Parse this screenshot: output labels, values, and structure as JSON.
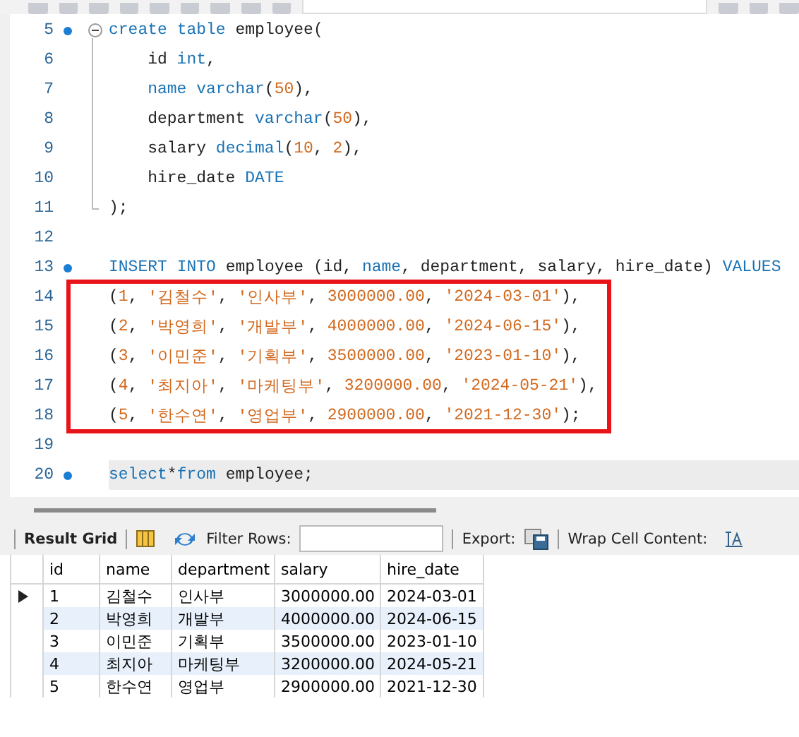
{
  "editor": {
    "lines": [
      {
        "number": "5",
        "marker": true,
        "boxed": false,
        "current": false,
        "expanded": true,
        "tokens": [
          {
            "kind": "keyword",
            "text": "create"
          },
          {
            "kind": "keyword",
            "text": " table"
          },
          {
            "kind": "plain",
            "text": " employee("
          }
        ],
        "children": [
          {
            "number": "6",
            "marker": false,
            "boxed": false,
            "current": false,
            "indented": true,
            "tokens": [
              {
                "kind": "plain",
                "text": "id"
              },
              {
                "kind": "keyword",
                "text": " int"
              },
              {
                "kind": "plain",
                "text": ","
              }
            ]
          },
          {
            "number": "7",
            "marker": false,
            "boxed": false,
            "current": false,
            "indented": true,
            "tokens": [
              {
                "kind": "keyword",
                "text": "name"
              },
              {
                "kind": "keyword",
                "text": " varchar"
              },
              {
                "kind": "plain",
                "text": "("
              },
              {
                "kind": "number",
                "text": "50"
              },
              {
                "kind": "plain",
                "text": "),"
              }
            ]
          },
          {
            "number": "8",
            "marker": false,
            "boxed": false,
            "current": false,
            "indented": true,
            "tokens": [
              {
                "kind": "plain",
                "text": "department"
              },
              {
                "kind": "keyword",
                "text": " varchar"
              },
              {
                "kind": "plain",
                "text": "("
              },
              {
                "kind": "number",
                "text": "50"
              },
              {
                "kind": "plain",
                "text": "),"
              }
            ]
          },
          {
            "number": "9",
            "marker": false,
            "boxed": false,
            "current": false,
            "indented": true,
            "tokens": [
              {
                "kind": "plain",
                "text": "salary"
              },
              {
                "kind": "keyword",
                "text": " decimal"
              },
              {
                "kind": "plain",
                "text": "("
              },
              {
                "kind": "number",
                "text": "10"
              },
              {
                "kind": "plain",
                "text": ","
              },
              {
                "kind": "number",
                "text": " 2"
              },
              {
                "kind": "plain",
                "text": "),"
              }
            ]
          },
          {
            "number": "10",
            "marker": false,
            "boxed": false,
            "current": false,
            "indented": true,
            "tokens": [
              {
                "kind": "plain",
                "text": "hire_date"
              },
              {
                "kind": "keyword",
                "text": " DATE"
              }
            ]
          },
          {
            "number": "11",
            "marker": false,
            "boxed": false,
            "current": false,
            "indented": false,
            "tokens": [
              {
                "kind": "plain",
                "text": ");"
              }
            ]
          }
        ]
      },
      {
        "number": "12",
        "marker": false,
        "boxed": false,
        "current": false
      },
      {
        "number": "13",
        "marker": true,
        "boxed": false,
        "current": false,
        "tokens": [
          {
            "kind": "keyword",
            "text": "INSERT"
          },
          {
            "kind": "keyword",
            "text": " INTO"
          },
          {
            "kind": "plain",
            "text": " employee (id,"
          },
          {
            "kind": "keyword",
            "text": " name"
          },
          {
            "kind": "plain",
            "text": ", department, salary, hire_date)"
          },
          {
            "kind": "keyword",
            "text": " VALUES"
          }
        ]
      },
      {
        "number": "14",
        "marker": false,
        "boxed": true,
        "current": false,
        "tokens": [
          {
            "kind": "plain",
            "text": "("
          },
          {
            "kind": "number",
            "text": "1"
          },
          {
            "kind": "plain",
            "text": ","
          },
          {
            "kind": "string",
            "text": " '김철수'"
          },
          {
            "kind": "plain",
            "text": ","
          },
          {
            "kind": "string",
            "text": " '인사부'"
          },
          {
            "kind": "plain",
            "text": ","
          },
          {
            "kind": "number",
            "text": " 3000000.00"
          },
          {
            "kind": "plain",
            "text": ","
          },
          {
            "kind": "string",
            "text": " '2024-03-01'"
          },
          {
            "kind": "plain",
            "text": "),"
          }
        ]
      },
      {
        "number": "15",
        "marker": false,
        "boxed": true,
        "current": false,
        "tokens": [
          {
            "kind": "plain",
            "text": "("
          },
          {
            "kind": "number",
            "text": "2"
          },
          {
            "kind": "plain",
            "text": ","
          },
          {
            "kind": "string",
            "text": " '박영희'"
          },
          {
            "kind": "plain",
            "text": ","
          },
          {
            "kind": "string",
            "text": " '개발부'"
          },
          {
            "kind": "plain",
            "text": ","
          },
          {
            "kind": "number",
            "text": " 4000000.00"
          },
          {
            "kind": "plain",
            "text": ","
          },
          {
            "kind": "string",
            "text": " '2024-06-15'"
          },
          {
            "kind": "plain",
            "text": "),"
          }
        ]
      },
      {
        "number": "16",
        "marker": false,
        "boxed": true,
        "current": false,
        "tokens": [
          {
            "kind": "plain",
            "text": "("
          },
          {
            "kind": "number",
            "text": "3"
          },
          {
            "kind": "plain",
            "text": ","
          },
          {
            "kind": "string",
            "text": " '이민준'"
          },
          {
            "kind": "plain",
            "text": ","
          },
          {
            "kind": "string",
            "text": " '기획부'"
          },
          {
            "kind": "plain",
            "text": ","
          },
          {
            "kind": "number",
            "text": " 3500000.00"
          },
          {
            "kind": "plain",
            "text": ","
          },
          {
            "kind": "string",
            "text": " '2023-01-10'"
          },
          {
            "kind": "plain",
            "text": "),"
          }
        ]
      },
      {
        "number": "17",
        "marker": false,
        "boxed": true,
        "current": false,
        "tokens": [
          {
            "kind": "plain",
            "text": "("
          },
          {
            "kind": "number",
            "text": "4"
          },
          {
            "kind": "plain",
            "text": ","
          },
          {
            "kind": "string",
            "text": " '최지아'"
          },
          {
            "kind": "plain",
            "text": ","
          },
          {
            "kind": "string",
            "text": " '마케팅부'"
          },
          {
            "kind": "plain",
            "text": ","
          },
          {
            "kind": "number",
            "text": " 3200000.00"
          },
          {
            "kind": "plain",
            "text": ","
          },
          {
            "kind": "string",
            "text": " '2024-05-21'"
          },
          {
            "kind": "plain",
            "text": "),"
          }
        ]
      },
      {
        "number": "18",
        "marker": false,
        "boxed": true,
        "current": false,
        "tokens": [
          {
            "kind": "plain",
            "text": "("
          },
          {
            "kind": "number",
            "text": "5"
          },
          {
            "kind": "plain",
            "text": ","
          },
          {
            "kind": "string",
            "text": " '한수연'"
          },
          {
            "kind": "plain",
            "text": ","
          },
          {
            "kind": "string",
            "text": " '영업부'"
          },
          {
            "kind": "plain",
            "text": ","
          },
          {
            "kind": "number",
            "text": " 2900000.00"
          },
          {
            "kind": "plain",
            "text": ","
          },
          {
            "kind": "string",
            "text": " '2021-12-30'"
          },
          {
            "kind": "plain",
            "text": ");"
          }
        ]
      },
      {
        "number": "19",
        "marker": false,
        "boxed": false,
        "current": false
      },
      {
        "number": "20",
        "marker": true,
        "boxed": false,
        "current": true,
        "tokens": [
          {
            "kind": "keyword",
            "text": "select"
          },
          {
            "kind": "plain",
            "text": "*"
          },
          {
            "kind": "keyword",
            "text": "from"
          },
          {
            "kind": "plain",
            "text": " employee;"
          }
        ]
      }
    ]
  },
  "result_toolbar": {
    "title": "Result Grid",
    "filter_label": "Filter Rows:",
    "export_label": "Export:",
    "wrap_label": "Wrap Cell Content:"
  },
  "result_grid": {
    "columns": [
      "id",
      "name",
      "department",
      "salary",
      "hire_date"
    ],
    "rows": [
      {
        "selected": true,
        "cells": [
          "1",
          "김철수",
          "인사부",
          "3000000.00",
          "2024-03-01"
        ]
      },
      {
        "selected": false,
        "cells": [
          "2",
          "박영희",
          "개발부",
          "4000000.00",
          "2024-06-15"
        ]
      },
      {
        "selected": false,
        "cells": [
          "3",
          "이민준",
          "기획부",
          "3500000.00",
          "2023-01-10"
        ]
      },
      {
        "selected": false,
        "cells": [
          "4",
          "최지아",
          "마케팅부",
          "3200000.00",
          "2024-05-21"
        ]
      },
      {
        "selected": false,
        "cells": [
          "5",
          "한수연",
          "영업부",
          "2900000.00",
          "2021-12-30"
        ]
      }
    ]
  }
}
